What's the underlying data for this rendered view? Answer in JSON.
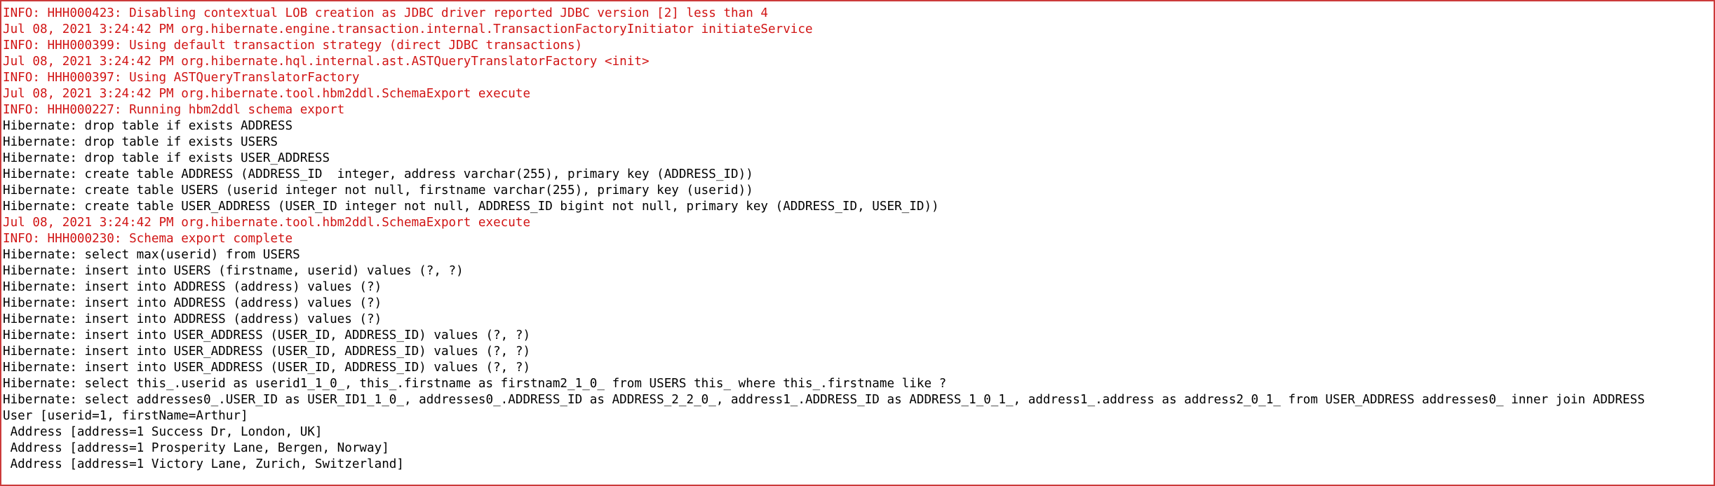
{
  "console": {
    "border_color": "#cc3a3a",
    "stderr_color": "#d11414",
    "stdout_color": "#000000",
    "lines": [
      {
        "text": "INFO: HHH000423: Disabling contextual LOB creation as JDBC driver reported JDBC version [2] less than 4",
        "stream": "err"
      },
      {
        "text": "Jul 08, 2021 3:24:42 PM org.hibernate.engine.transaction.internal.TransactionFactoryInitiator initiateService",
        "stream": "err"
      },
      {
        "text": "INFO: HHH000399: Using default transaction strategy (direct JDBC transactions)",
        "stream": "err"
      },
      {
        "text": "Jul 08, 2021 3:24:42 PM org.hibernate.hql.internal.ast.ASTQueryTranslatorFactory <init>",
        "stream": "err"
      },
      {
        "text": "INFO: HHH000397: Using ASTQueryTranslatorFactory",
        "stream": "err"
      },
      {
        "text": "Jul 08, 2021 3:24:42 PM org.hibernate.tool.hbm2ddl.SchemaExport execute",
        "stream": "err"
      },
      {
        "text": "INFO: HHH000227: Running hbm2ddl schema export",
        "stream": "err"
      },
      {
        "text": "Hibernate: drop table if exists ADDRESS",
        "stream": "out"
      },
      {
        "text": "Hibernate: drop table if exists USERS",
        "stream": "out"
      },
      {
        "text": "Hibernate: drop table if exists USER_ADDRESS",
        "stream": "out"
      },
      {
        "text": "Hibernate: create table ADDRESS (ADDRESS_ID  integer, address varchar(255), primary key (ADDRESS_ID))",
        "stream": "out"
      },
      {
        "text": "Hibernate: create table USERS (userid integer not null, firstname varchar(255), primary key (userid))",
        "stream": "out"
      },
      {
        "text": "Hibernate: create table USER_ADDRESS (USER_ID integer not null, ADDRESS_ID bigint not null, primary key (ADDRESS_ID, USER_ID))",
        "stream": "out"
      },
      {
        "text": "Jul 08, 2021 3:24:42 PM org.hibernate.tool.hbm2ddl.SchemaExport execute",
        "stream": "err"
      },
      {
        "text": "INFO: HHH000230: Schema export complete",
        "stream": "err"
      },
      {
        "text": "Hibernate: select max(userid) from USERS",
        "stream": "out"
      },
      {
        "text": "Hibernate: insert into USERS (firstname, userid) values (?, ?)",
        "stream": "out"
      },
      {
        "text": "Hibernate: insert into ADDRESS (address) values (?)",
        "stream": "out"
      },
      {
        "text": "Hibernate: insert into ADDRESS (address) values (?)",
        "stream": "out"
      },
      {
        "text": "Hibernate: insert into ADDRESS (address) values (?)",
        "stream": "out"
      },
      {
        "text": "Hibernate: insert into USER_ADDRESS (USER_ID, ADDRESS_ID) values (?, ?)",
        "stream": "out"
      },
      {
        "text": "Hibernate: insert into USER_ADDRESS (USER_ID, ADDRESS_ID) values (?, ?)",
        "stream": "out"
      },
      {
        "text": "Hibernate: insert into USER_ADDRESS (USER_ID, ADDRESS_ID) values (?, ?)",
        "stream": "out"
      },
      {
        "text": "Hibernate: select this_.userid as userid1_1_0_, this_.firstname as firstnam2_1_0_ from USERS this_ where this_.firstname like ?",
        "stream": "out"
      },
      {
        "text": "Hibernate: select addresses0_.USER_ID as USER_ID1_1_0_, addresses0_.ADDRESS_ID as ADDRESS_2_2_0_, address1_.ADDRESS_ID as ADDRESS_1_0_1_, address1_.address as address2_0_1_ from USER_ADDRESS addresses0_ inner join ADDRESS",
        "stream": "out"
      },
      {
        "text": "User [userid=1, firstName=Arthur]",
        "stream": "out"
      },
      {
        "text": " Address [address=1 Success Dr, London, UK]",
        "stream": "out"
      },
      {
        "text": " Address [address=1 Prosperity Lane, Bergen, Norway]",
        "stream": "out"
      },
      {
        "text": " Address [address=1 Victory Lane, Zurich, Switzerland]",
        "stream": "out"
      }
    ]
  }
}
